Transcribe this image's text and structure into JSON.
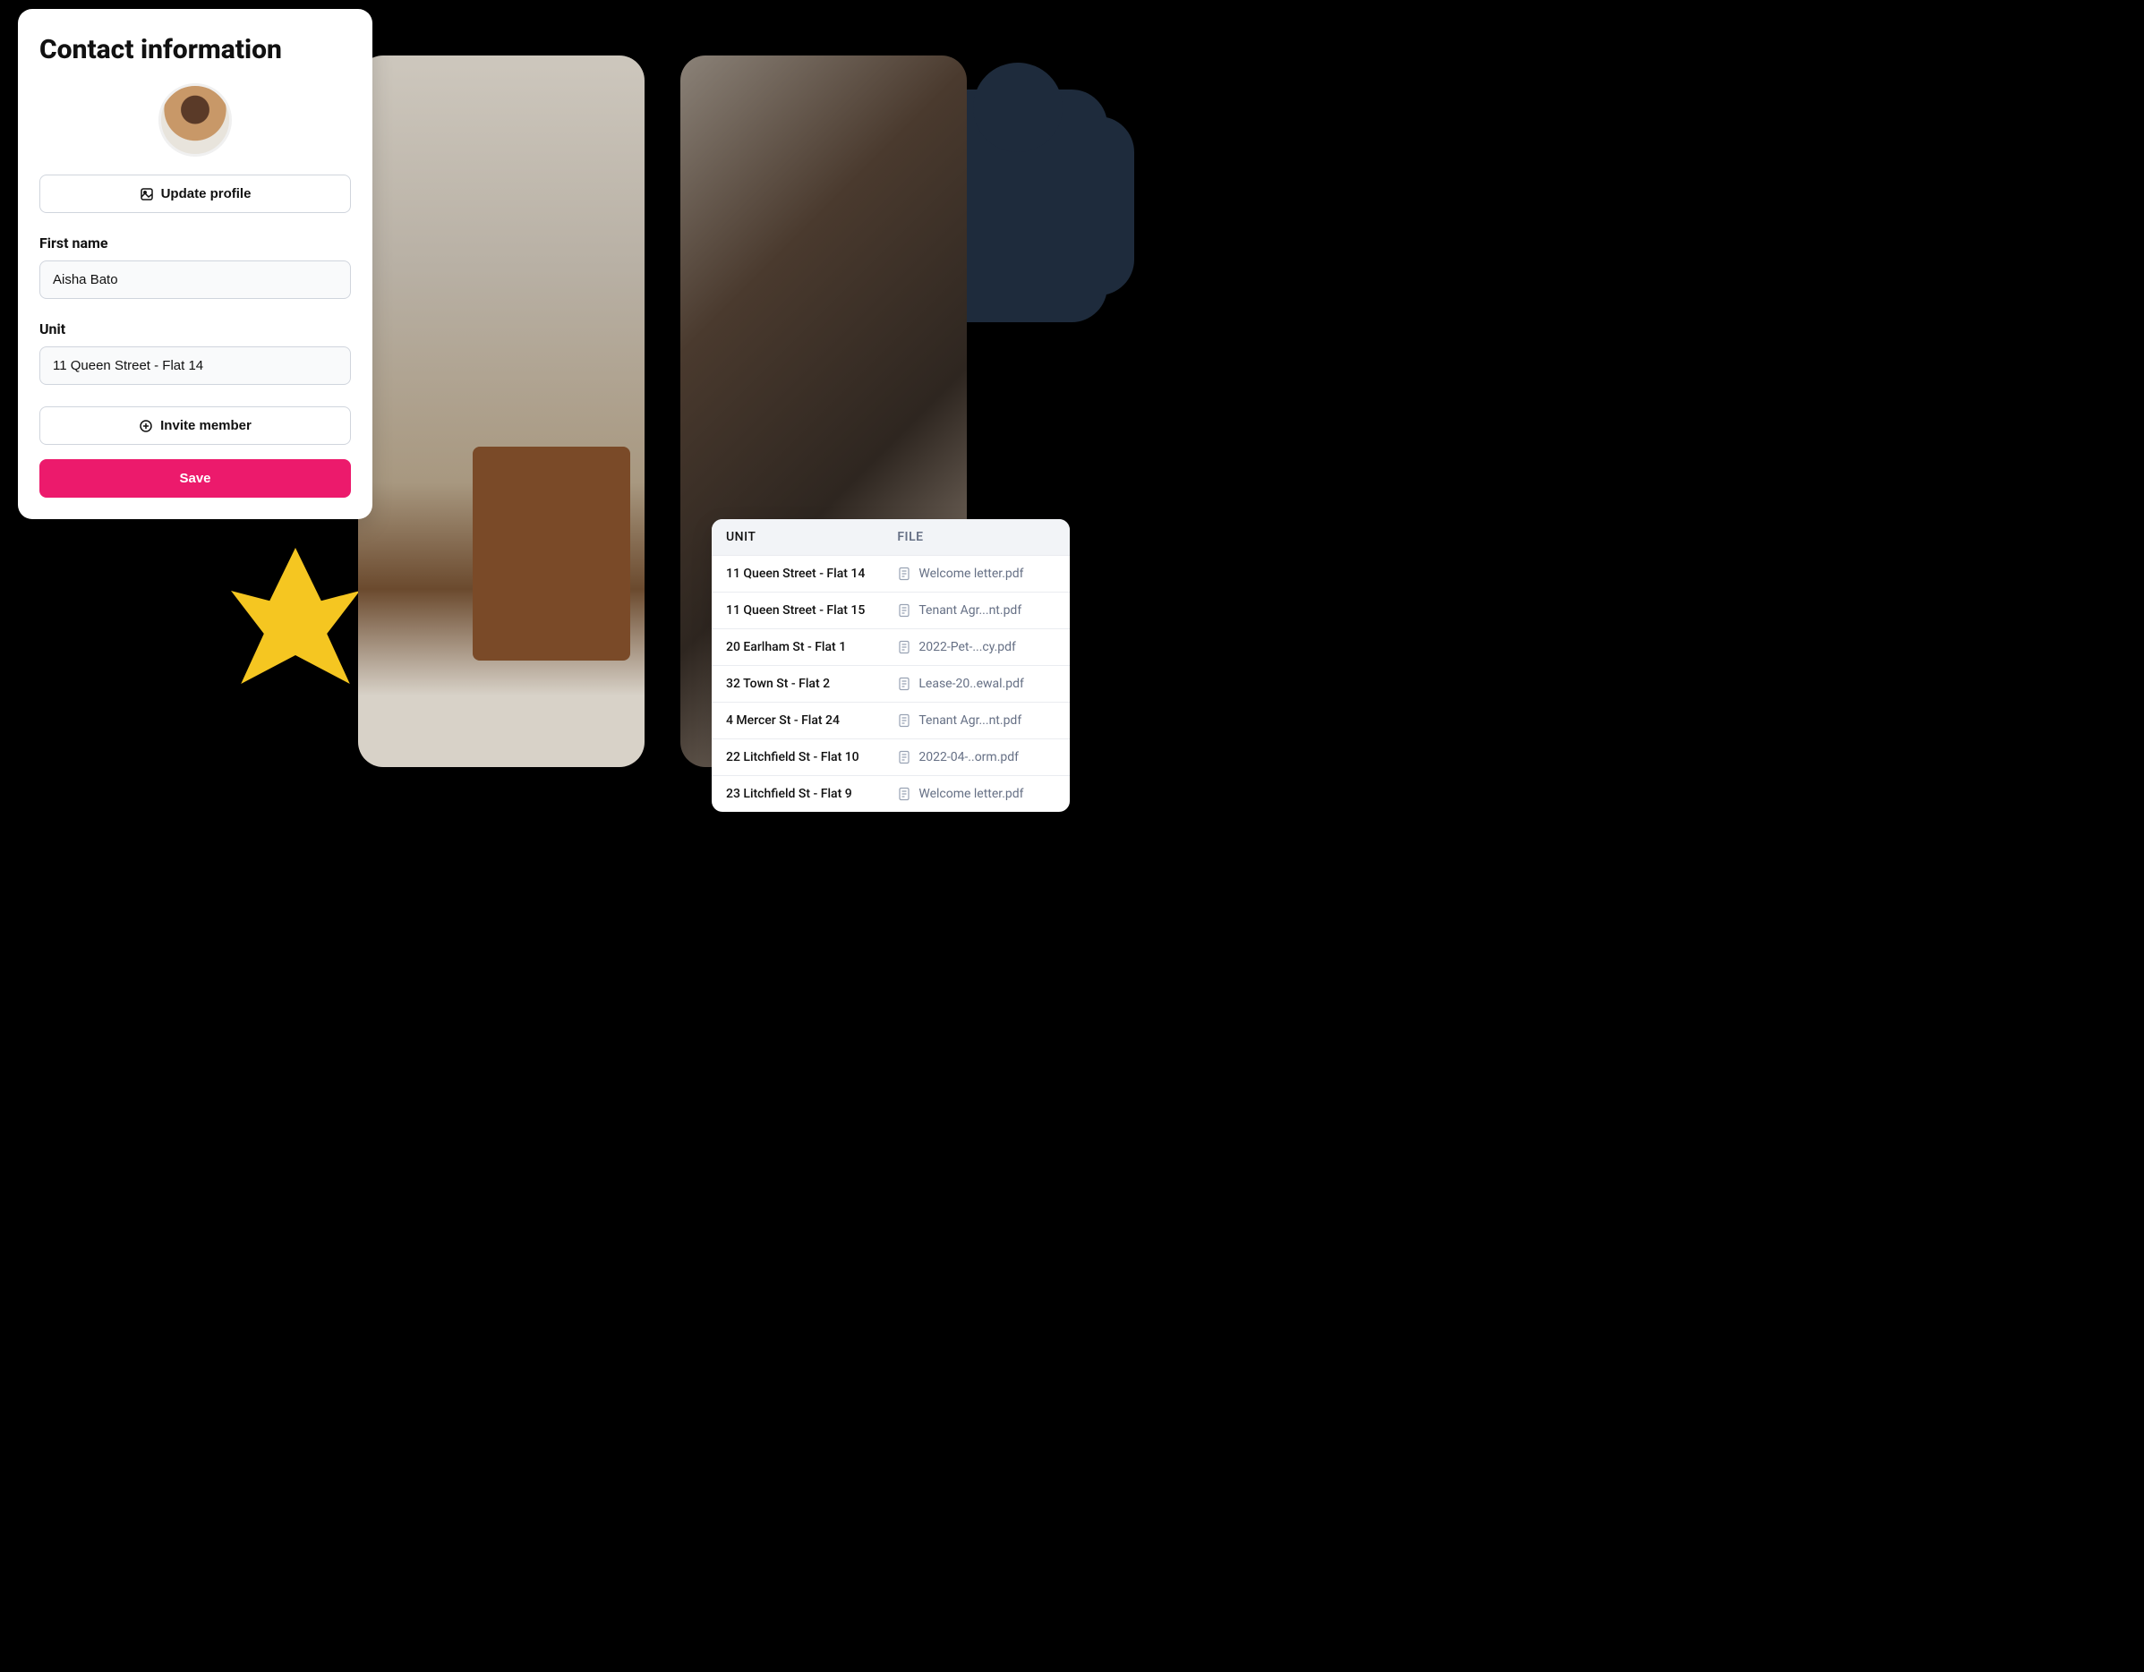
{
  "contact": {
    "title": "Contact information",
    "update_profile_label": "Update profile",
    "first_name_label": "First name",
    "first_name_value": "Aisha Bato",
    "unit_label": "Unit",
    "unit_value": "11 Queen Street - Flat 14",
    "invite_member_label": "Invite member",
    "save_label": "Save"
  },
  "files_table": {
    "header_unit": "UNIT",
    "header_file": "FILE",
    "rows": [
      {
        "unit": "11 Queen Street - Flat 14",
        "file": "Welcome letter.pdf"
      },
      {
        "unit": "11 Queen Street - Flat 15",
        "file": "Tenant Agr...nt.pdf"
      },
      {
        "unit": "20 Earlham St - Flat 1",
        "file": "2022-Pet-...cy.pdf"
      },
      {
        "unit": "32 Town St - Flat 2",
        "file": "Lease-20..ewal.pdf"
      },
      {
        "unit": "4 Mercer St - Flat 24",
        "file": "Tenant Agr...nt.pdf"
      },
      {
        "unit": "22 Litchfield St - Flat 10",
        "file": "2022-04-..orm.pdf"
      },
      {
        "unit": "23 Litchfield St - Flat 9",
        "file": "Welcome letter.pdf"
      }
    ]
  }
}
